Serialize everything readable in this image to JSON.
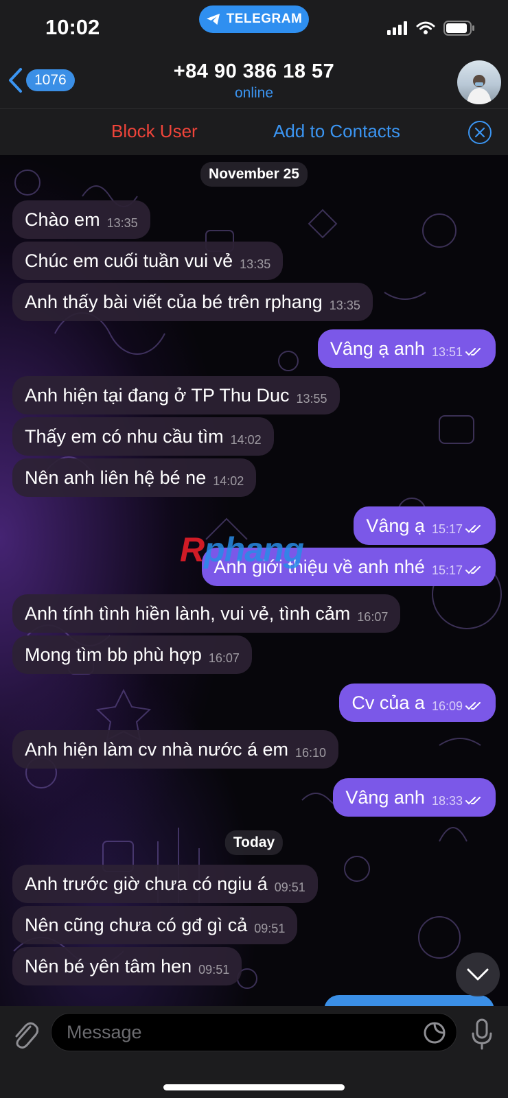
{
  "status_bar": {
    "time": "10:02",
    "app_pill": "TELEGRAM",
    "icons": [
      "signal-icon",
      "wifi-icon",
      "battery-icon"
    ]
  },
  "header": {
    "back_count": "1076",
    "title": "+84 90 386 18 57",
    "status": "online"
  },
  "action_bar": {
    "block_label": "Block User",
    "add_contacts_label": "Add to Contacts"
  },
  "dates": {
    "first": "November 25",
    "second": "Today"
  },
  "messages": [
    {
      "dir": "in",
      "text": "Chào em",
      "time": "13:35"
    },
    {
      "dir": "in",
      "text": "Chúc em cuối tuần vui vẻ",
      "time": "13:35"
    },
    {
      "dir": "in",
      "text": "Anh thấy bài viết của bé trên rphang",
      "time": "13:35"
    },
    {
      "dir": "out",
      "text": "Vâng ạ anh",
      "time": "13:51"
    },
    {
      "dir": "in",
      "text": "Anh hiện tại đang ở TP Thu Duc",
      "time": "13:55"
    },
    {
      "dir": "in",
      "text": "Thấy em có nhu cầu tìm",
      "time": "14:02"
    },
    {
      "dir": "in",
      "text": "Nên anh liên hệ bé ne",
      "time": "14:02"
    },
    {
      "dir": "out",
      "text": "Vâng ạ",
      "time": "15:17"
    },
    {
      "dir": "out",
      "text": "Anh giới thiệu về anh nhé",
      "time": "15:17"
    },
    {
      "dir": "in",
      "text": "Anh tính tình hiền lành, vui vẻ, tình cảm",
      "time": "16:07"
    },
    {
      "dir": "in",
      "text": "Mong tìm bb phù hợp",
      "time": "16:07"
    },
    {
      "dir": "out",
      "text": "Cv của a",
      "time": "16:09"
    },
    {
      "dir": "in",
      "text": "Anh hiện làm cv nhà nước á em",
      "time": "16:10"
    },
    {
      "dir": "out",
      "text": "Vâng anh",
      "time": "18:33"
    },
    {
      "dir": "in",
      "text": "Anh trước giờ chưa có ngiu á",
      "time": "09:51"
    },
    {
      "dir": "in",
      "text": "Nên cũng chưa có gđ gì cả",
      "time": "09:51"
    },
    {
      "dir": "in",
      "text": "Nên bé yên tâm hen",
      "time": "09:51"
    }
  ],
  "watermark": {
    "first_letter": "R",
    "rest": "phang"
  },
  "input": {
    "placeholder": "Message"
  },
  "colors": {
    "outgoing_bubble": "#7b58e8",
    "incoming_bubble": "#2c2234",
    "accent_blue": "#3b95f2",
    "danger_red": "#f0443a"
  }
}
